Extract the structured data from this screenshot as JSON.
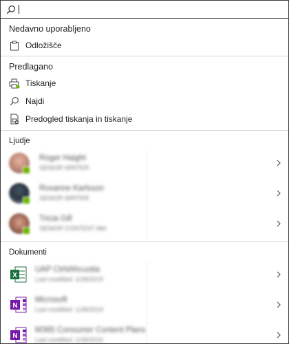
{
  "search": {
    "value": "",
    "placeholder": ""
  },
  "recent": {
    "header": "Nedavno uporabljeno",
    "items": [
      {
        "label": "Odložišče",
        "icon": "clipboard-icon"
      }
    ]
  },
  "suggested": {
    "header": "Predlagano",
    "items": [
      {
        "label": "Tiskanje",
        "icon": "printer-icon"
      },
      {
        "label": "Najdi",
        "icon": "search-icon"
      },
      {
        "label": "Predogled tiskanja in tiskanje",
        "icon": "print-preview-icon"
      }
    ]
  },
  "people": {
    "header": "Ljudje",
    "items": [
      {
        "name": "Roger Haight",
        "subtitle": "SENIOR WRITER"
      },
      {
        "name": "Roxanne Karlsson",
        "subtitle": "SENIOR WRITER"
      },
      {
        "name": "Tricia Gill",
        "subtitle": "SENIOR CONTENT Mkt"
      }
    ]
  },
  "documents": {
    "header": "Dokumenti",
    "items": [
      {
        "name": "UAP Ctrlshhcuotia",
        "modified": "Last modified: 1/28/2019",
        "icon": "excel-icon"
      },
      {
        "name": "Microsoft",
        "modified": "Last modified: 1/28/2019",
        "icon": "onenote-icon"
      },
      {
        "name": "M365 Consumer Content Plans",
        "modified": "Last modified: 1/28/2019",
        "icon": "onenote-icon"
      }
    ]
  },
  "colors": {
    "presence": "#6bb700",
    "excel": "#1d6f42",
    "onenote": "#7719aa"
  }
}
